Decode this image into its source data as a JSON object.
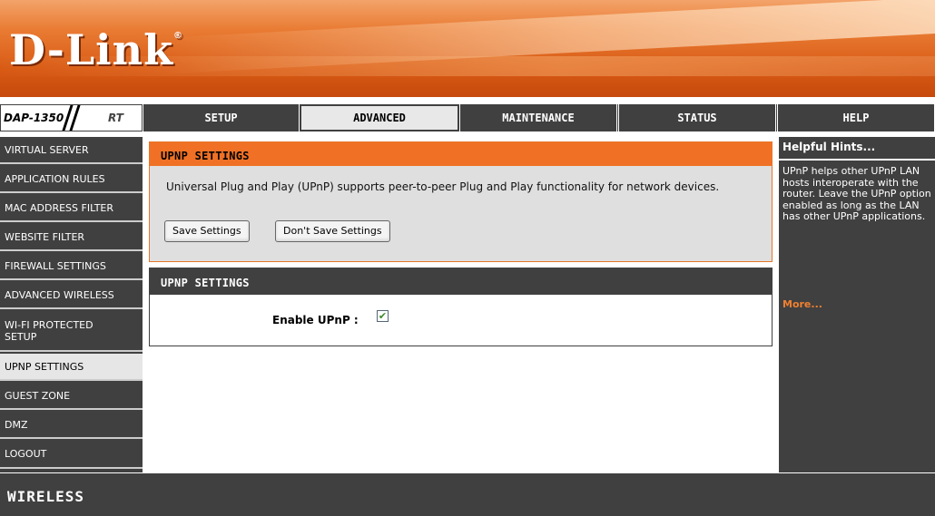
{
  "brand": {
    "logo": "D-Link",
    "reg": "®"
  },
  "model": {
    "name": "DAP-1350",
    "suffix": "RT"
  },
  "nav": {
    "tabs": [
      {
        "label": "SETUP",
        "active": false
      },
      {
        "label": "ADVANCED",
        "active": true
      },
      {
        "label": "MAINTENANCE",
        "active": false
      },
      {
        "label": "STATUS",
        "active": false
      },
      {
        "label": "HELP",
        "active": false
      }
    ]
  },
  "sidebar": {
    "items": [
      {
        "label": "VIRTUAL SERVER",
        "active": false
      },
      {
        "label": "APPLICATION RULES",
        "active": false
      },
      {
        "label": "MAC ADDRESS FILTER",
        "active": false
      },
      {
        "label": "WEBSITE FILTER",
        "active": false
      },
      {
        "label": "FIREWALL SETTINGS",
        "active": false
      },
      {
        "label": "ADVANCED WIRELESS",
        "active": false
      },
      {
        "label": "WI-FI PROTECTED SETUP",
        "active": false
      },
      {
        "label": "UPNP SETTINGS",
        "active": true
      },
      {
        "label": "GUEST ZONE",
        "active": false
      },
      {
        "label": "DMZ",
        "active": false
      },
      {
        "label": "LOGOUT",
        "active": false
      }
    ]
  },
  "main": {
    "intro": {
      "title": "UPNP SETTINGS",
      "description": "Universal Plug and Play (UPnP) supports peer-to-peer Plug and Play functionality for network devices.",
      "save_label": "Save Settings",
      "dont_save_label": "Don't Save Settings"
    },
    "settings": {
      "title": "UPNP SETTINGS",
      "enable_label": "Enable UPnP :",
      "enable_checked": true
    }
  },
  "help": {
    "title": "Helpful Hints...",
    "text": "UPnP helps other UPnP LAN hosts interoperate with the router. Leave the UPnP option enabled as long as the LAN has other UPnP applications.",
    "more": "More..."
  },
  "footer": {
    "label": "WIRELESS"
  },
  "colors": {
    "accent": "#f07125",
    "dark": "#404040",
    "more_link": "#f08030"
  }
}
